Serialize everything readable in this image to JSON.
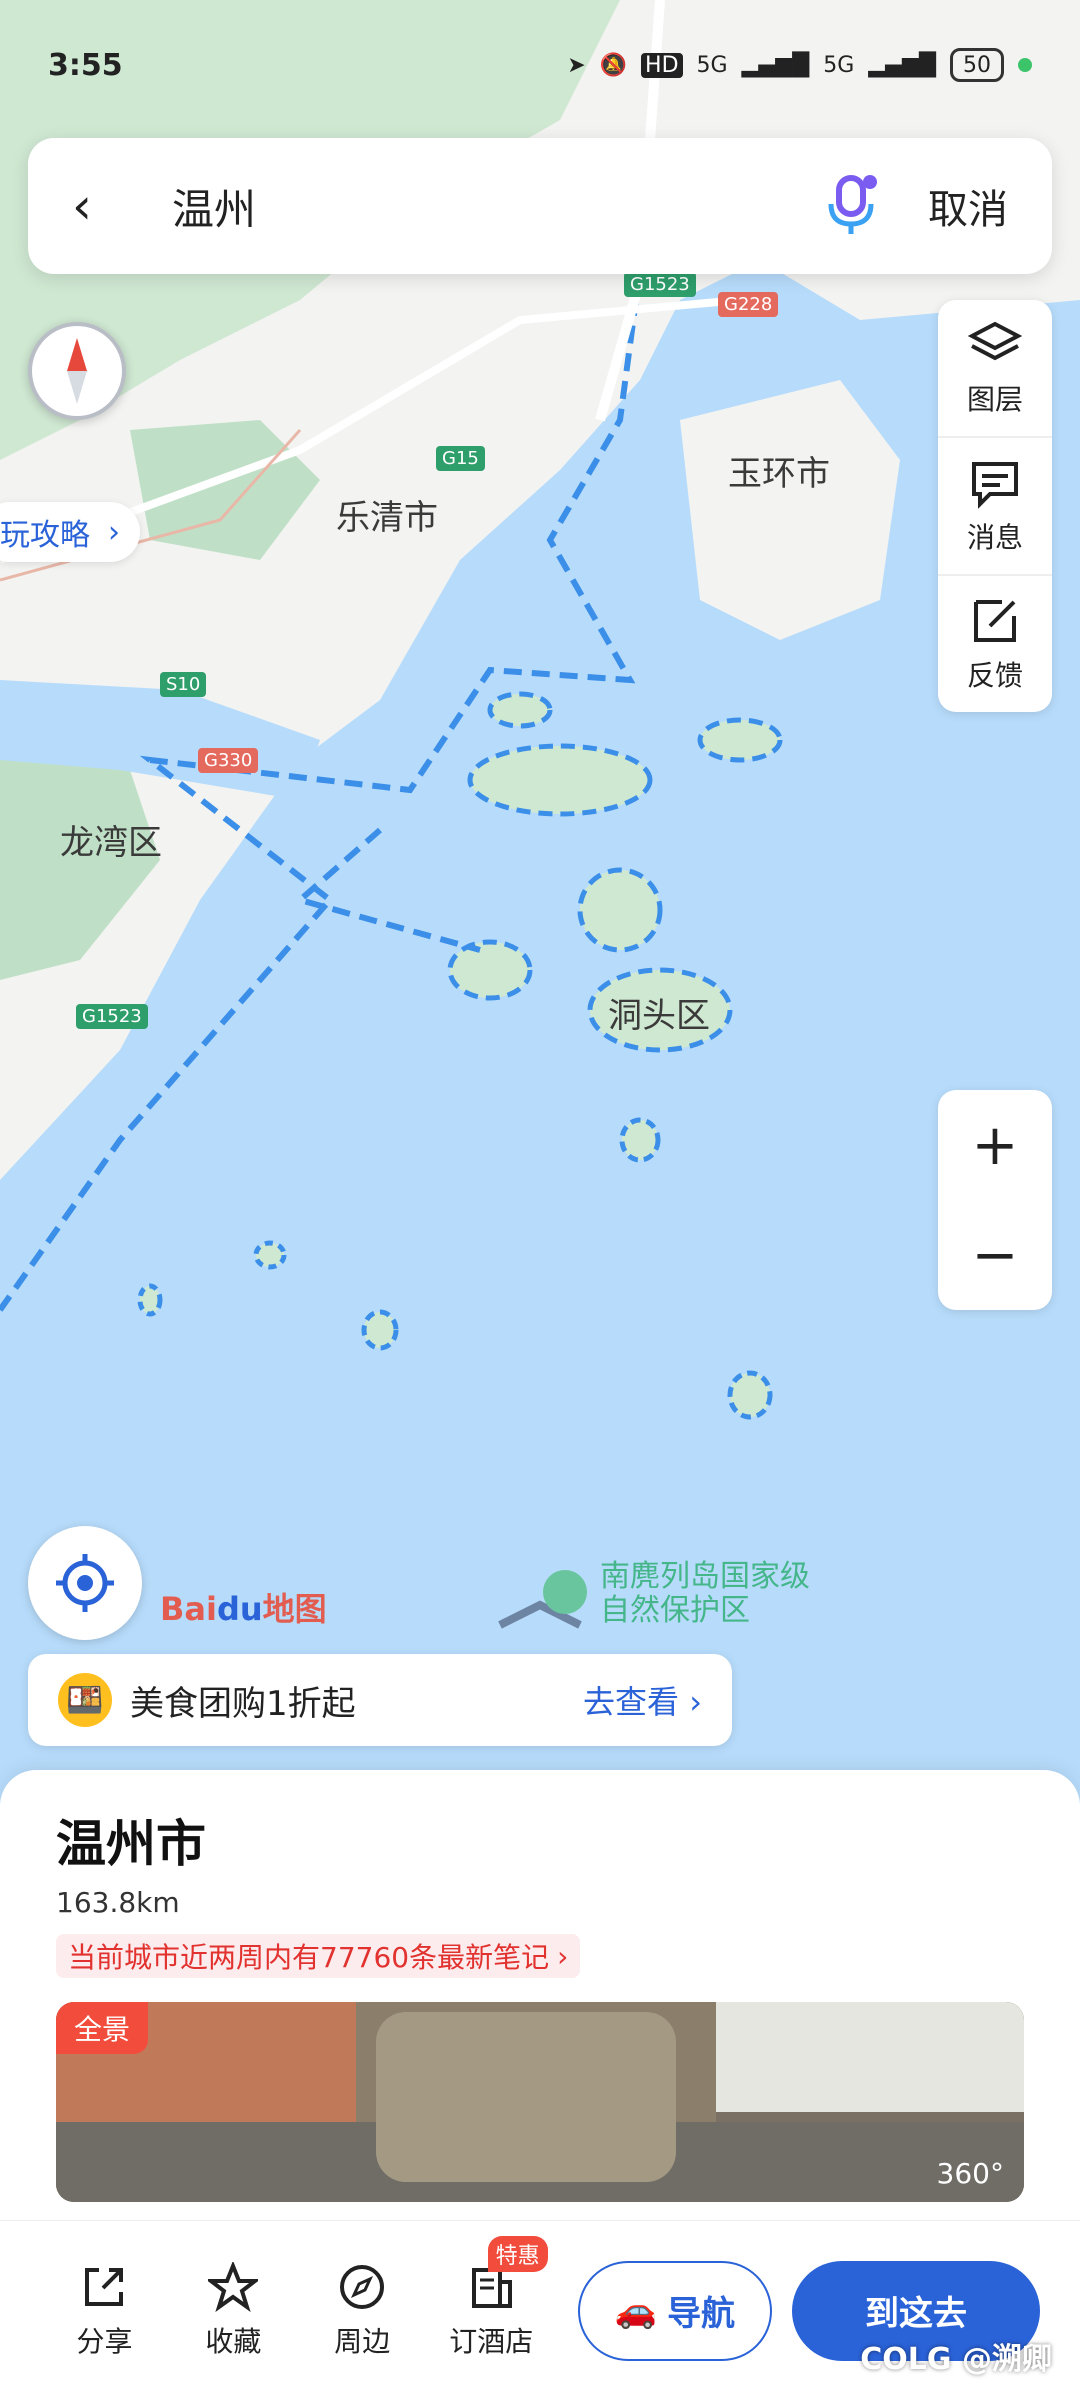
{
  "status_bar": {
    "time": "3:55",
    "network_1": "5G",
    "network_2": "5G",
    "hd": "HD",
    "battery": "50"
  },
  "search": {
    "query": "温州",
    "cancel_label": "取消"
  },
  "right_tools": {
    "layers": "图层",
    "messages": "消息",
    "feedback": "反馈"
  },
  "strategy_pill": {
    "label": "玩攻略"
  },
  "map_labels": {
    "yueqing": "乐清市",
    "yuhuan": "玉环市",
    "longwan": "龙湾区",
    "dongtou": "洞头区",
    "reserve_line1": "南麂列岛国家级",
    "reserve_line2": "自然保护区",
    "roads": {
      "g1523_top": "G1523",
      "g228": "G228",
      "g15": "G15",
      "s10": "S10",
      "g330": "G330",
      "g1523_left": "G1523"
    },
    "baidu_text": "Bai",
    "baidu_du": "du",
    "baidu_map": "地图"
  },
  "zoom": {
    "in": "+",
    "out": "−"
  },
  "promo": {
    "text": "美食团购1折起",
    "link": "去查看"
  },
  "place_card": {
    "title": "温州市",
    "distance": "163.8km",
    "notes": "当前城市近两周内有77760条最新笔记",
    "pano_badge": "全景",
    "pano_360": "360°"
  },
  "bottom_bar": {
    "share": "分享",
    "favorite": "收藏",
    "nearby": "周边",
    "hotel": "订酒店",
    "hotel_badge": "特惠",
    "navigate": "导航",
    "go": "到这去"
  },
  "watermark": "COLG @溯卿"
}
